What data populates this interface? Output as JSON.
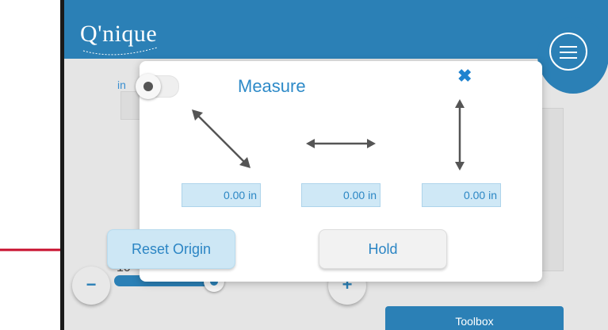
{
  "app": {
    "logo_text": "Q'nique"
  },
  "dialog": {
    "title": "Measure",
    "units_toggle_label": "in",
    "units_toggle_on": false,
    "fields": [
      {
        "value": "0.00 in",
        "axis": "diagonal"
      },
      {
        "value": "0.00 in",
        "axis": "horizontal"
      },
      {
        "value": "0.00 in",
        "axis": "vertical"
      }
    ],
    "reset_label": "Reset Origin",
    "hold_label": "Hold"
  },
  "background": {
    "slider_value": "10",
    "minus_label": "−",
    "plus_label": "+",
    "toolbox_label": "Toolbox"
  },
  "colors": {
    "brand": "#2b80b6",
    "accent_text": "#2d8ac8",
    "annotation_arrow": "#c8102e"
  }
}
